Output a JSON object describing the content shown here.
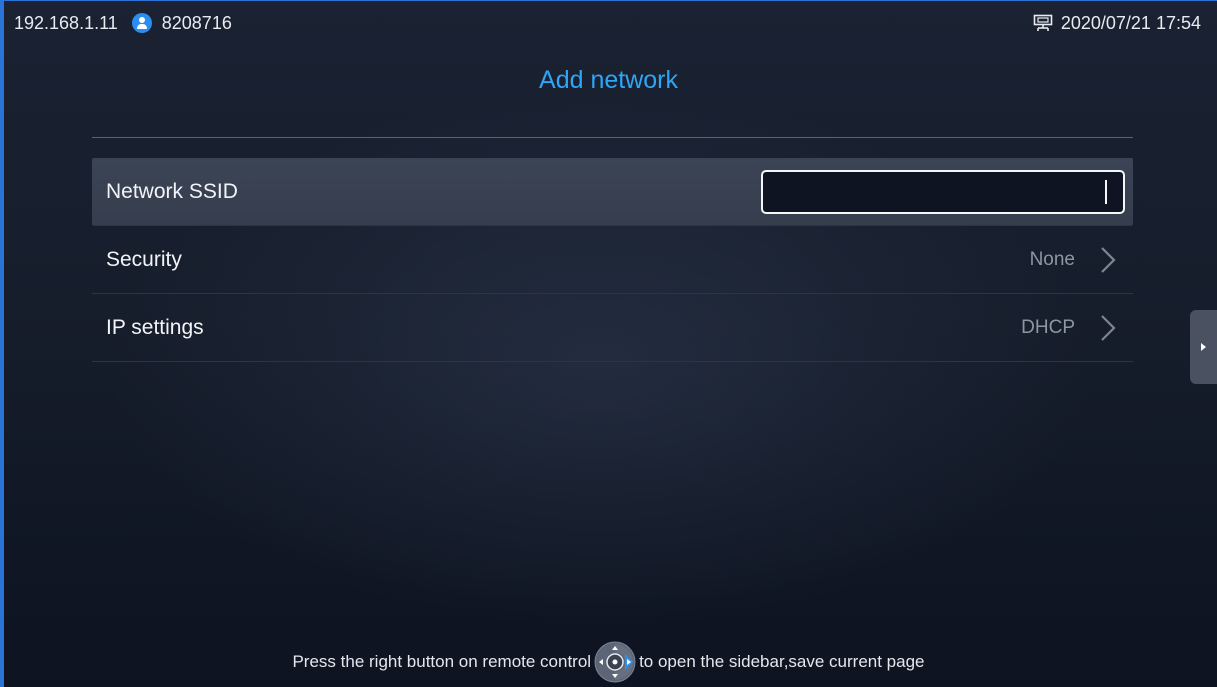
{
  "status_bar": {
    "ip_address": "192.168.1.11",
    "account_icon": "account-icon",
    "account_number": "8208716",
    "network_icon": "lan-icon",
    "datetime": "2020/07/21 17:54"
  },
  "page": {
    "title": "Add network"
  },
  "settings": {
    "ssid": {
      "label": "Network SSID",
      "value": ""
    },
    "security": {
      "label": "Security",
      "value": "None"
    },
    "ip": {
      "label": "IP settings",
      "value": "DHCP"
    }
  },
  "hint": {
    "before": "Press the right button on remote control",
    "after": "to open the sidebar,save current page",
    "icon": "remote-dpad-icon"
  },
  "colors": {
    "accent": "#2ea5f5",
    "frame": "#2a74d8",
    "selected_row": "#3b4455"
  }
}
